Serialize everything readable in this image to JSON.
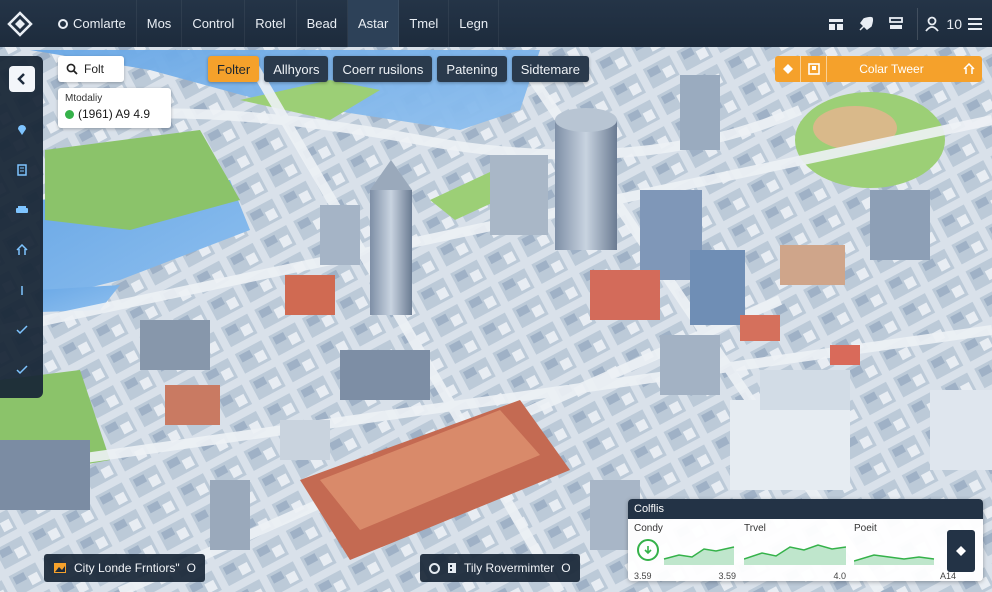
{
  "topbar": {
    "menu": [
      {
        "label": "Comlarte",
        "icon": "circle-icon",
        "active": false
      },
      {
        "label": "Mos",
        "active": false
      },
      {
        "label": "Control",
        "active": false
      },
      {
        "label": "Rotel",
        "active": false
      },
      {
        "label": "Bead",
        "active": false
      },
      {
        "label": "Astar",
        "active": true
      },
      {
        "label": "Tmel",
        "active": false
      },
      {
        "label": "Legn",
        "active": false
      }
    ],
    "tools": [
      "bar-chart-icon",
      "rocket-icon",
      "layers-icon"
    ],
    "user_count": "10"
  },
  "sidebar": {
    "items": [
      "location-pin-icon",
      "document-icon",
      "vehicle-icon",
      "home-icon",
      "info-icon",
      "check-icon",
      "check-icon"
    ]
  },
  "search": {
    "placeholder": "Folt"
  },
  "info_card": {
    "label": "Mtodaliy",
    "value": "(1961) A9 4.9",
    "status_color": "#35b24a"
  },
  "tabs": [
    {
      "label": "Folter",
      "active": true
    },
    {
      "label": "Allhyors",
      "active": false
    },
    {
      "label": "Coerr rusilons",
      "active": false
    },
    {
      "label": "Patening",
      "active": false
    },
    {
      "label": "Sidtemare",
      "active": false
    }
  ],
  "orange_panel": {
    "label": "Colar Tweer"
  },
  "bottom_left": {
    "label": "City Londe Frntiors\"",
    "trailing": "O"
  },
  "bottom_center": {
    "label": "Tily Rovermimter",
    "trailing": "O"
  },
  "stats": {
    "title": "Colflis",
    "metrics": [
      {
        "label": "Condy",
        "left": "3.59",
        "right": "3.59"
      },
      {
        "label": "Trvel",
        "left": "",
        "right": "4.0"
      },
      {
        "label": "Poeit",
        "left": "",
        "right": "A14"
      }
    ]
  },
  "colors": {
    "accent": "#f5a12b",
    "panel": "#1d2b3c",
    "status_green": "#35b24a"
  }
}
